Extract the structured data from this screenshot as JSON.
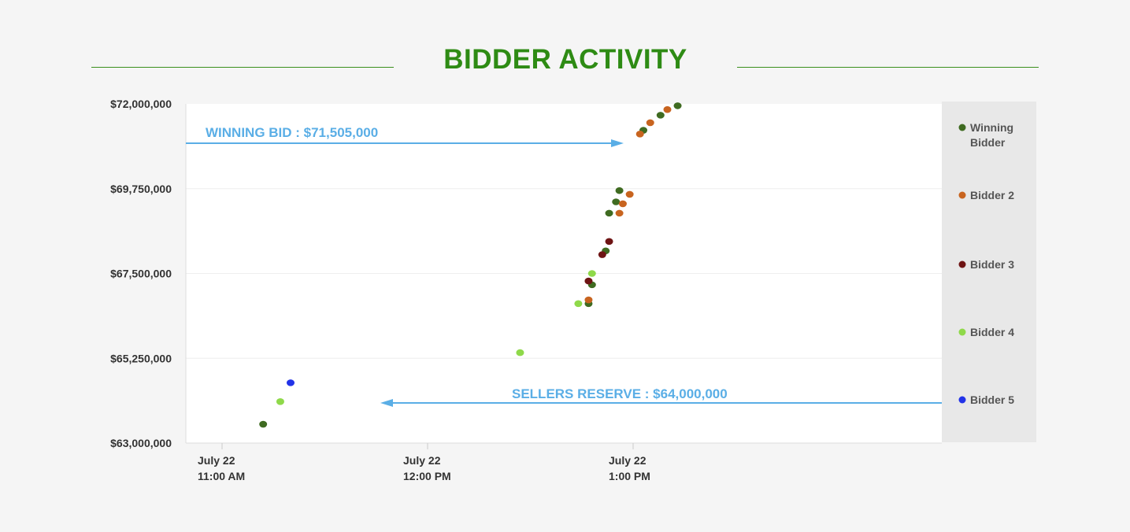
{
  "chart_data": {
    "type": "scatter",
    "title": "BIDDER ACTIVITY",
    "x_axis": {
      "type": "time",
      "ticks": [
        {
          "line1": "July 22",
          "line2": "11:00 AM",
          "value": "11:00"
        },
        {
          "line1": "July 22",
          "line2": "12:00 PM",
          "value": "12:00"
        },
        {
          "line1": "July 22",
          "line2": "1:00 PM",
          "value": "13:00"
        }
      ]
    },
    "y_axis": {
      "ylim": [
        63000000,
        72000000
      ],
      "ticks": [
        {
          "value": 72000000,
          "label": "$72,000,000"
        },
        {
          "value": 69750000,
          "label": "$69,750,000"
        },
        {
          "value": 67500000,
          "label": "$67,500,000"
        },
        {
          "value": 65250000,
          "label": "$65,250,000"
        },
        {
          "value": 63000000,
          "label": "$63,000,000"
        }
      ]
    },
    "grid": true,
    "legend_position": "right",
    "series": [
      {
        "name": "Winning Bidder",
        "color": "#3f6b21",
        "points": [
          {
            "x": "11:12",
            "y": 63500000
          },
          {
            "x": "12:47",
            "y": 66700000
          },
          {
            "x": "12:48",
            "y": 67200000
          },
          {
            "x": "12:52",
            "y": 68100000
          },
          {
            "x": "12:53",
            "y": 69100000
          },
          {
            "x": "12:55",
            "y": 69400000
          },
          {
            "x": "12:56",
            "y": 69700000
          },
          {
            "x": "13:03",
            "y": 71300000
          },
          {
            "x": "13:08",
            "y": 71700000
          },
          {
            "x": "13:13",
            "y": 71950000
          }
        ]
      },
      {
        "name": "Bidder 2",
        "color": "#c8641f",
        "points": [
          {
            "x": "12:47",
            "y": 66800000
          },
          {
            "x": "12:56",
            "y": 69100000
          },
          {
            "x": "12:57",
            "y": 69350000
          },
          {
            "x": "12:59",
            "y": 69600000
          },
          {
            "x": "13:02",
            "y": 71200000
          },
          {
            "x": "13:05",
            "y": 71500000
          },
          {
            "x": "13:10",
            "y": 71850000
          }
        ]
      },
      {
        "name": "Bidder 3",
        "color": "#6e1414",
        "points": [
          {
            "x": "12:47",
            "y": 67300000
          },
          {
            "x": "12:51",
            "y": 68000000
          },
          {
            "x": "12:53",
            "y": 68350000
          }
        ]
      },
      {
        "name": "Bidder 4",
        "color": "#8fd94a",
        "points": [
          {
            "x": "11:17",
            "y": 64100000
          },
          {
            "x": "12:27",
            "y": 65400000
          },
          {
            "x": "12:44",
            "y": 66700000
          },
          {
            "x": "12:48",
            "y": 67500000
          }
        ]
      },
      {
        "name": "Bidder 5",
        "color": "#2233e8",
        "points": [
          {
            "x": "11:20",
            "y": 64600000
          }
        ]
      }
    ],
    "annotations": [
      {
        "text": "WINNING BID : $71,505,000",
        "value": 71505000
      },
      {
        "text": "SELLERS RESERVE : $64,000,000",
        "value": 64000000
      }
    ]
  }
}
